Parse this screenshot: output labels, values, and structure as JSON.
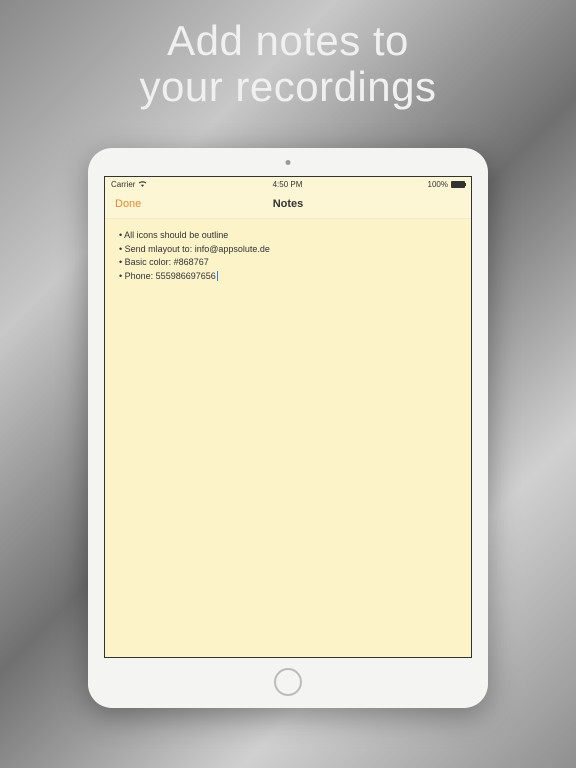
{
  "promo": {
    "line1": "Add notes to",
    "line2": "your recordings"
  },
  "statusBar": {
    "carrier": "Carrier",
    "time": "4:50 PM",
    "battery": "100%"
  },
  "navBar": {
    "done": "Done",
    "title": "Notes"
  },
  "notes": {
    "lines": [
      "• All icons should be outline",
      "• Send mlayout to: info@appsolute.de",
      "• Basic color: #868767",
      "• Phone: 555986697656"
    ]
  }
}
